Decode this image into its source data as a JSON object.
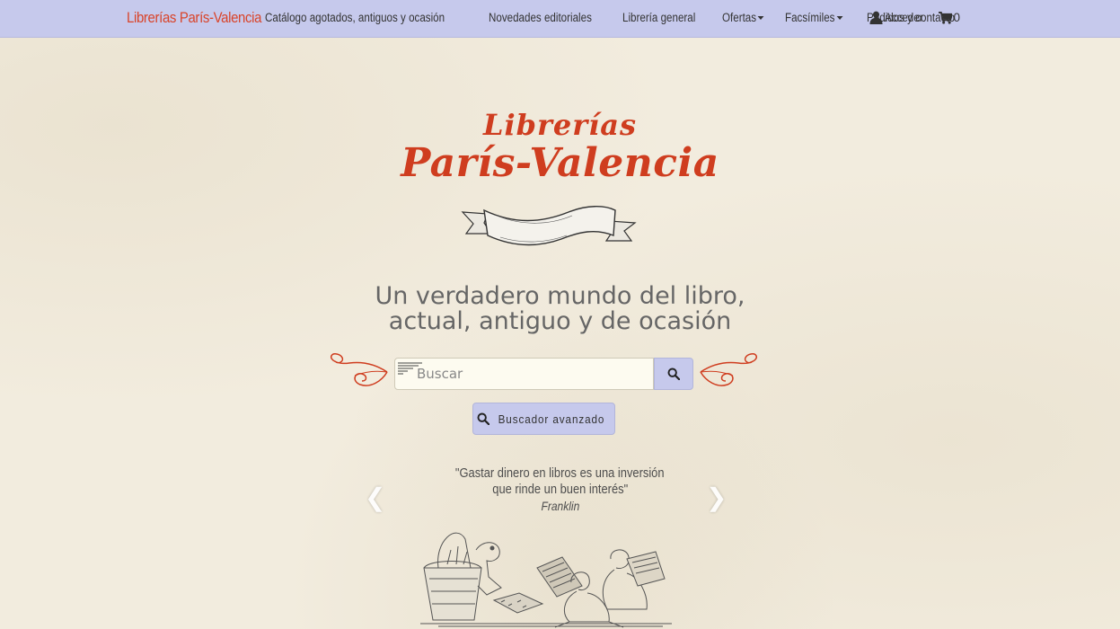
{
  "navbar": {
    "brand": "Librerías París-Valencia",
    "links": [
      {
        "label": "Catálogo agotados, antiguos y ocasión",
        "dropdown": false
      },
      {
        "label": "Novedades editoriales",
        "dropdown": false
      },
      {
        "label": "Librería general",
        "dropdown": false
      },
      {
        "label": "Ofertas",
        "dropdown": true
      },
      {
        "label": "Facsímiles",
        "dropdown": true
      },
      {
        "label": "Pedidos y contacto",
        "dropdown": false
      }
    ],
    "login_label": "Acceder",
    "cart_count": "0",
    "background": "#c6c9ec"
  },
  "logo": {
    "line1": "Librerías",
    "line2": "París-Valencia",
    "color": "#cf3d1f"
  },
  "tagline": {
    "line1": "Un verdadero mundo del libro,",
    "line2": "actual, antiguo y de ocasión"
  },
  "search": {
    "placeholder": "Buscar",
    "button_icon": "search-icon",
    "advanced_label": "Buscador avanzado"
  },
  "quote": {
    "line1": "\"Gastar dinero en libros es una inversión",
    "line2": "que rinde un buen interés\"",
    "author": "Franklin"
  }
}
